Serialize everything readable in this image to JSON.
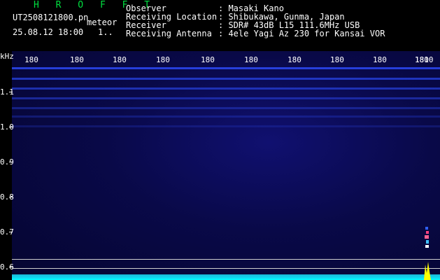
{
  "header": {
    "title": "H R O F F T",
    "filename": "UT2508121800.pn",
    "meteor_label": "meteor",
    "date_time": "25.08.12 18:00",
    "count": "1..",
    "meta": [
      {
        "label": "Observer",
        "value": ": Masaki Kano"
      },
      {
        "label": "Receiving Location",
        "value": ": Shibukawa, Gunma, Japan"
      },
      {
        "label": "Receiver",
        "value": ": SDR# 43dB L15 111.6MHz USB"
      },
      {
        "label": "Receiving Antenna",
        "value": ": 4ele Yagi Az 230 for Kansai VOR"
      }
    ]
  },
  "spectrogram": {
    "y_unit": "kHz",
    "y_ticks": [
      "1.1",
      "1.0",
      "0.9",
      "0.8",
      "0.7",
      "0.6"
    ],
    "x_ticks": [
      "180",
      "180",
      "180",
      "180",
      "180",
      "180",
      "180",
      "180",
      "180",
      "180",
      "1810"
    ],
    "colors": {
      "background": "#090948",
      "band": "#3a5cff",
      "floor": "#00ffff",
      "echo": "#ffff00"
    }
  }
}
